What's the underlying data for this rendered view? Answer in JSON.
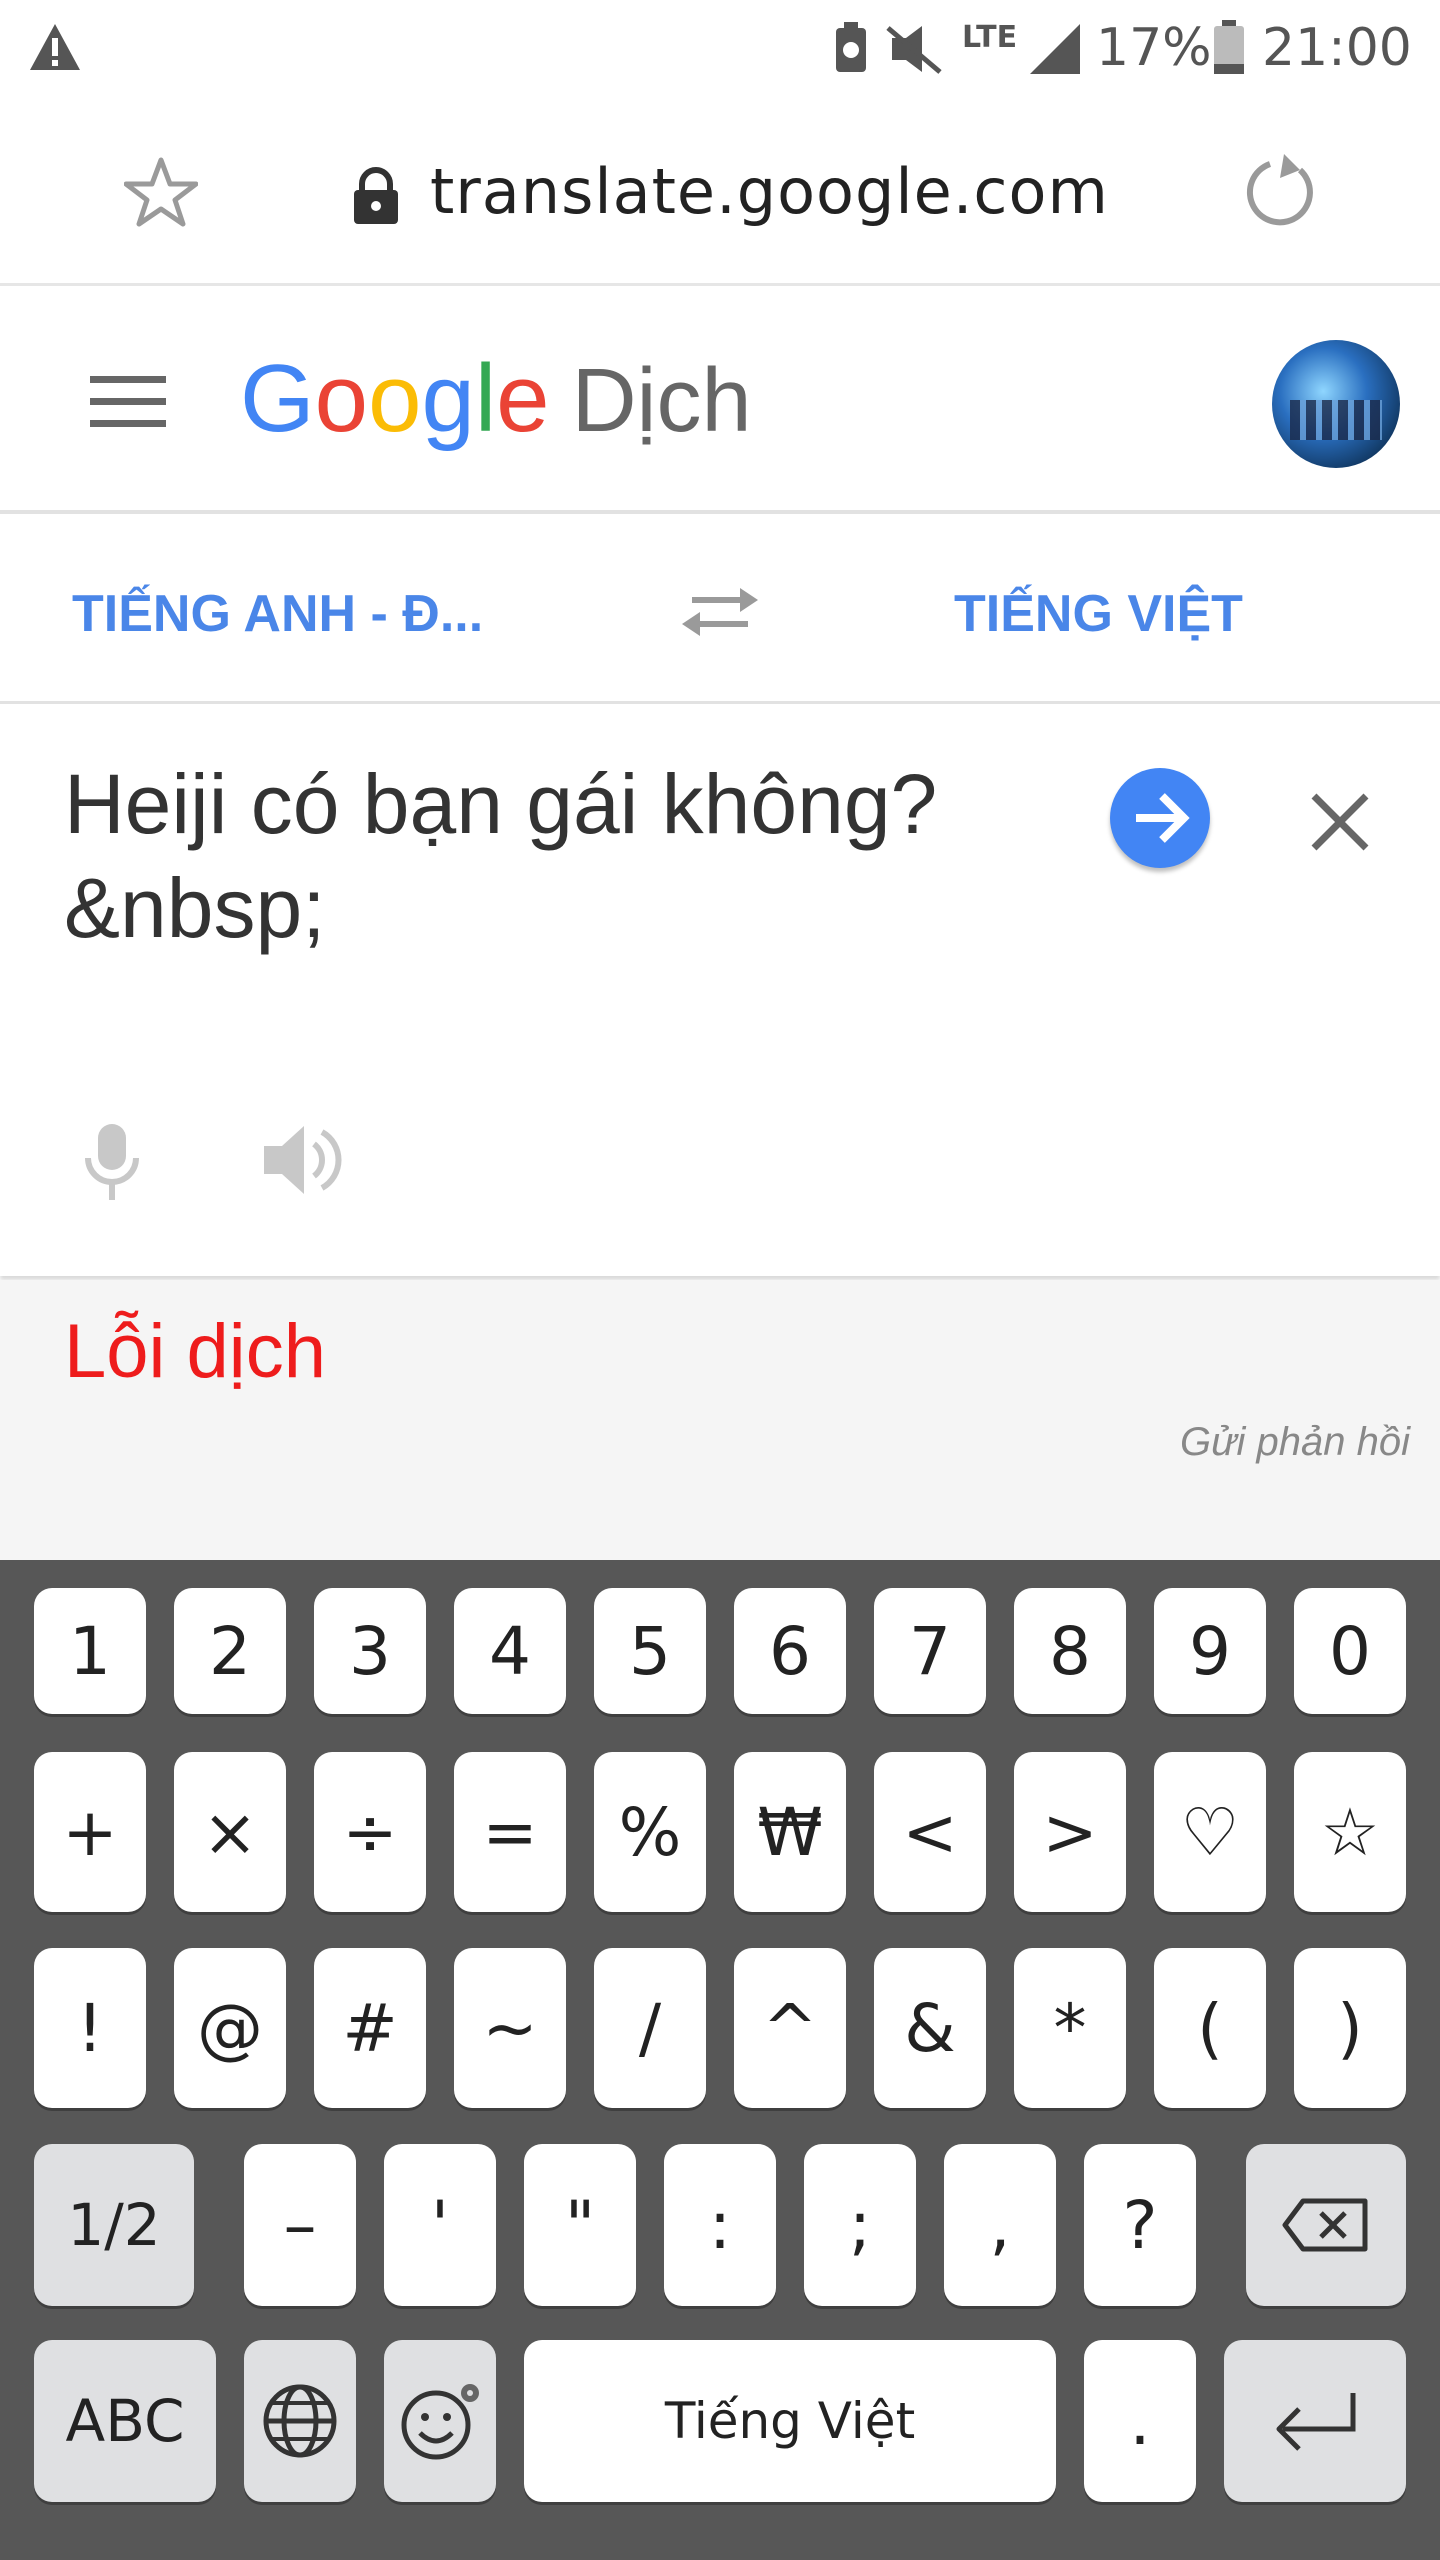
{
  "status_bar": {
    "alert_icon": "warning-triangle-icon",
    "network": "LTE",
    "battery": "17%",
    "time": "21:00"
  },
  "browser": {
    "url": "translate.google.com"
  },
  "header": {
    "logo": "Google",
    "app_name": "Dịch"
  },
  "languages": {
    "source": "TIẾNG ANH - Đ...",
    "target": "TIẾNG VIỆT"
  },
  "input": {
    "text": "Heiji có bạn gái không?\n&nbsp;"
  },
  "result": {
    "error": "Lỗi dịch",
    "feedback": "Gửi phản hồi"
  },
  "keyboard": {
    "row1": [
      "1",
      "2",
      "3",
      "4",
      "5",
      "6",
      "7",
      "8",
      "9",
      "0"
    ],
    "row2": [
      "+",
      "×",
      "÷",
      "=",
      "%",
      "₩",
      "<",
      ">",
      "♡",
      "☆"
    ],
    "row3": [
      "!",
      "@",
      "#",
      "~",
      "/",
      "^",
      "&",
      "*",
      "(",
      ")"
    ],
    "row4": [
      "1/2",
      "–",
      "'",
      "\"",
      ":",
      ";",
      ",",
      "?"
    ],
    "row5": {
      "abc": "ABC",
      "space": "Tiếng Việt",
      "period": "."
    }
  },
  "colors": {
    "google_blue": "#4285f4",
    "google_red": "#ea4335",
    "google_yellow": "#fbbc05",
    "google_green": "#34a853",
    "lang_blue": "#4a86e8",
    "error_red": "#ee1c1c",
    "keyboard_bg": "#575757"
  }
}
